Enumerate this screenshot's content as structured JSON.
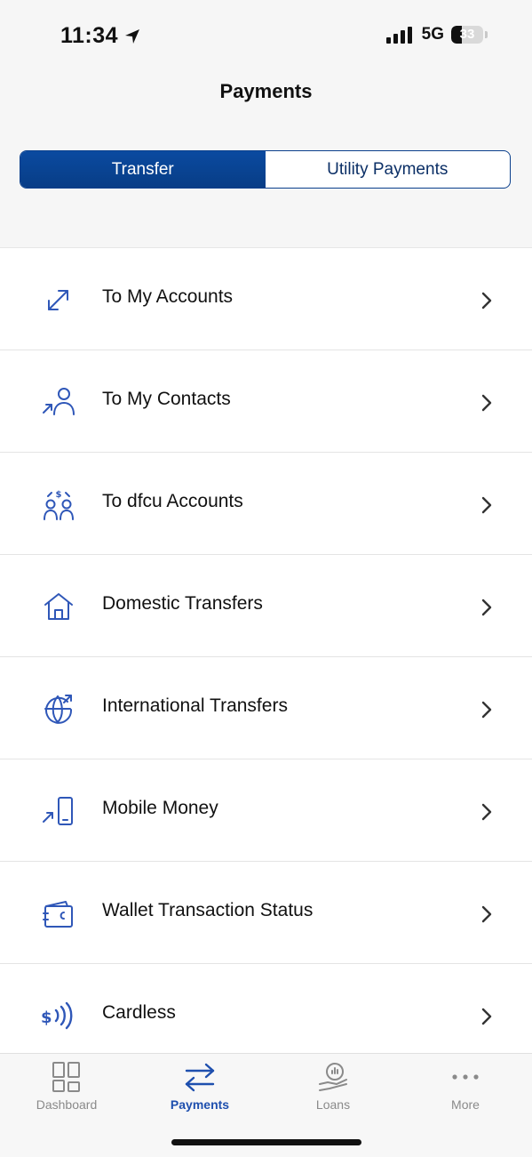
{
  "status_bar": {
    "time": "11:34",
    "network": "5G",
    "battery": "33",
    "battery_level": 0.33
  },
  "page": {
    "title": "Payments"
  },
  "segments": {
    "transfer": "Transfer",
    "utility": "Utility Payments"
  },
  "menu": [
    {
      "label": "To My Accounts",
      "icon": "arrows-diagonal-icon"
    },
    {
      "label": "To My Contacts",
      "icon": "contact-send-icon"
    },
    {
      "label": "To dfcu Accounts",
      "icon": "people-exchange-icon"
    },
    {
      "label": "Domestic Transfers",
      "icon": "home-icon"
    },
    {
      "label": "International Transfers",
      "icon": "globe-arrow-icon"
    },
    {
      "label": "Mobile Money",
      "icon": "mobile-send-icon"
    },
    {
      "label": "Wallet Transaction Status",
      "icon": "wallet-icon"
    },
    {
      "label": "Cardless",
      "icon": "contactless-cash-icon"
    }
  ],
  "tabs": [
    {
      "label": "Dashboard",
      "icon": "dashboard-grid-icon"
    },
    {
      "label": "Payments",
      "icon": "transfer-arrows-icon"
    },
    {
      "label": "Loans",
      "icon": "loan-hand-icon"
    },
    {
      "label": "More",
      "icon": "more-dots-icon"
    }
  ],
  "colors": {
    "brand": "#0a4aa0",
    "accent_icon": "#2f57b8",
    "active_tab": "#1e4fae"
  }
}
